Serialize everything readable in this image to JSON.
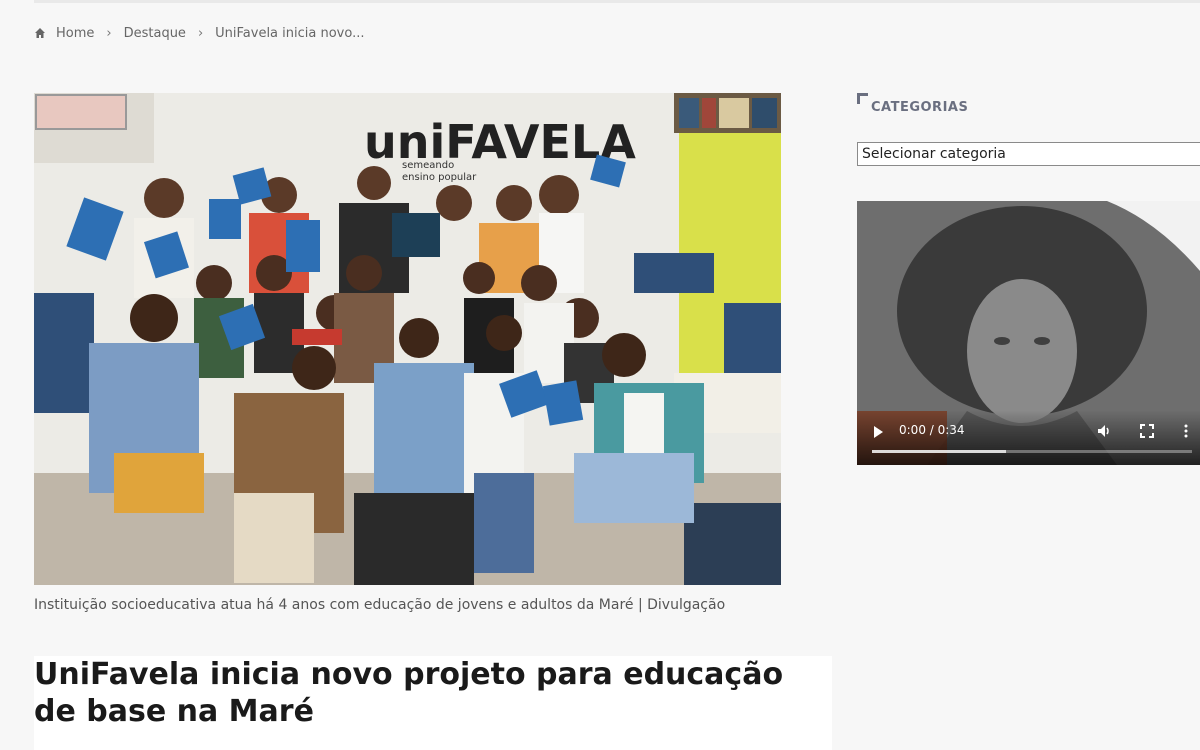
{
  "breadcrumb": {
    "home_icon": "home-icon",
    "items": [
      "Home",
      "Destaque",
      "UniFavela inicia novo..."
    ],
    "separator": "›"
  },
  "hero": {
    "wall_sign": {
      "brand": "uniFAVELA",
      "tagline_1": "semeando",
      "tagline_2": "ensino popular"
    }
  },
  "article": {
    "caption": "Instituição socioeducativa atua há 4 anos com educação de jovens e adultos da Maré | Divulgação",
    "title": "UniFavela inicia novo projeto para educação de base na Maré"
  },
  "sidebar": {
    "categories_title": "CATEGORIAS",
    "category_select_value": "Selecionar categoria",
    "video": {
      "time": "0:00 / 0:34",
      "play_icon": "play-icon",
      "volume_icon": "volume-icon",
      "fullscreen_icon": "fullscreen-icon",
      "more_icon": "more-options-icon",
      "buffered_fraction": 0.42
    }
  },
  "colors": {
    "page_bg": "#f7f7f7",
    "accent": "#6a6f80",
    "title": "#1a1a1a"
  }
}
